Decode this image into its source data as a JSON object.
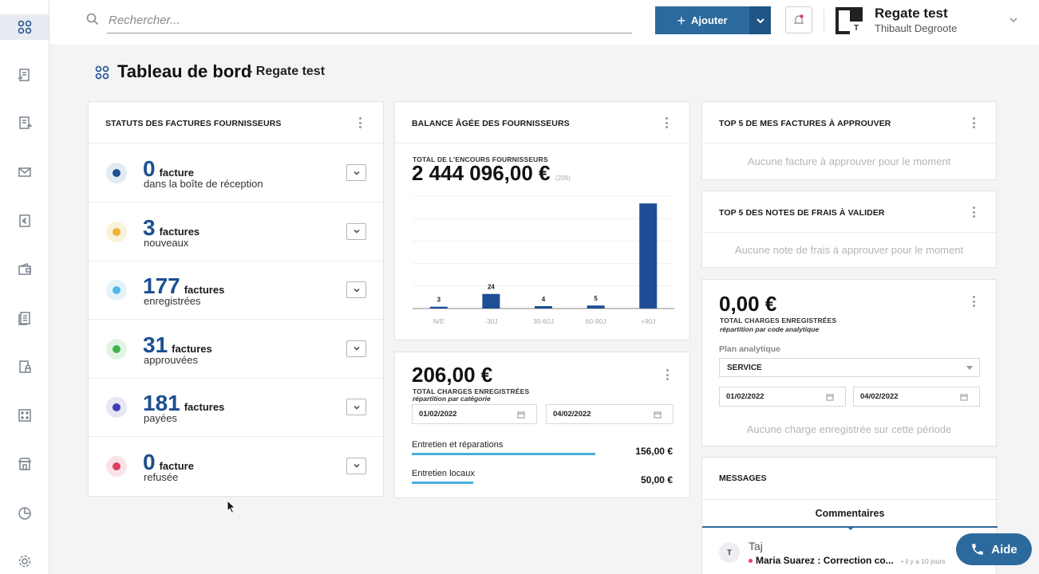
{
  "colors": {
    "brand": "#2c6a9e",
    "brand_dark": "#1f5585",
    "number_blue": "#1d4f91",
    "bar_blue": "#1f4e96",
    "progress_blue": "#4aaedd"
  },
  "sidebar": {
    "items": [
      {
        "name": "dashboard-icon",
        "active": true
      },
      {
        "name": "invoice-in-icon"
      },
      {
        "name": "invoice-out-icon"
      },
      {
        "name": "mail-icon"
      },
      {
        "name": "euro-document-icon"
      },
      {
        "name": "wallet-icon"
      },
      {
        "name": "documents-icon"
      },
      {
        "name": "lock-document-icon"
      },
      {
        "name": "grid-icon"
      },
      {
        "name": "store-icon"
      },
      {
        "name": "pie-chart-icon"
      },
      {
        "name": "gear-icon"
      }
    ]
  },
  "header": {
    "search_placeholder": "Rechercher...",
    "add_label": "Ajouter",
    "user_name": "Regate test",
    "user_sub": "Thibault Degroote",
    "avatar_letter": "T"
  },
  "page": {
    "title": "Tableau de bord",
    "subtitle": "- Regate test"
  },
  "statuses": {
    "title": "STATUTS DES FACTURES FOURNISSEURS",
    "rows": [
      {
        "num": "0",
        "unit": "facture",
        "label": "dans la boîte de réception",
        "dot": "#1d4f91",
        "ring": "#e3eaf3"
      },
      {
        "num": "3",
        "unit": "factures",
        "label": "nouveaux",
        "dot": "#f2b233",
        "ring": "#fbf2dc"
      },
      {
        "num": "177",
        "unit": "factures",
        "label": "enregistrées",
        "dot": "#4fb8e8",
        "ring": "#e4f3fa"
      },
      {
        "num": "31",
        "unit": "factures",
        "label": "approuvées",
        "dot": "#3eb54a",
        "ring": "#e2f3e4"
      },
      {
        "num": "181",
        "unit": "factures",
        "label": "payées",
        "dot": "#3f3fb5",
        "ring": "#e6e6f5"
      },
      {
        "num": "0",
        "unit": "facture",
        "label": "refusée",
        "dot": "#e0405c",
        "ring": "#fae3e7"
      }
    ]
  },
  "balance": {
    "title": "BALANCE ÂGÉE DES FOURNISSEURS",
    "total_label": "TOTAL DE L'ENCOURS FOURNISSEURS",
    "total_amount": "2 444 096,00 €",
    "total_count": "(209)"
  },
  "chart_data": {
    "type": "bar",
    "categories": [
      "N/E",
      "-30J",
      "30-60J",
      "60-90J",
      "+90J"
    ],
    "values": [
      3,
      24,
      4,
      5,
      173
    ],
    "data_labels": [
      "3",
      "24",
      "4",
      "5",
      ""
    ],
    "ylim": [
      0,
      185
    ],
    "grid": true
  },
  "charges_cat": {
    "amount": "206,00 €",
    "label": "TOTAL CHARGES ENREGISTRÉES",
    "sub": "répartition par catégorie",
    "date_from": "01/02/2022",
    "date_to": "04/02/2022",
    "items": [
      {
        "label": "Entretien et réparations",
        "value": "156,00 €",
        "fraction": 0.87
      },
      {
        "label": "Entretien locaux",
        "value": "50,00 €",
        "fraction": 0.29
      }
    ]
  },
  "top_invoices": {
    "title": "TOP 5 DE MES FACTURES À APPROUVER",
    "empty": "Aucune facture à approuver pour le moment"
  },
  "top_expenses": {
    "title": "TOP 5 DES NOTES DE FRAIS À VALIDER",
    "empty": "Aucune note de frais à approuver pour le moment"
  },
  "charges_analytic": {
    "amount": "0,00 €",
    "label": "TOTAL CHARGES ENREGISTRÉES",
    "sub": "répartition par code analytique",
    "plan_label": "Plan analytique",
    "plan_value": "SERVICE",
    "date_from": "01/02/2022",
    "date_to": "04/02/2022",
    "empty": "Aucune charge enregistrée sur cette période"
  },
  "messages": {
    "title": "MESSAGES",
    "tab": "Commentaires",
    "item": {
      "avatar": "T",
      "author": "Taj",
      "text": "Maria Suarez : Correction co...",
      "time": "• il y a 10 jours"
    }
  },
  "help": {
    "label": "Aide"
  }
}
